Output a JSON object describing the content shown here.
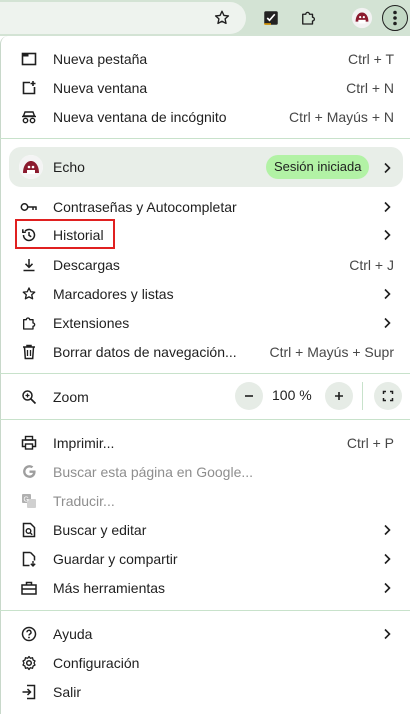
{
  "menu": {
    "new_tab": {
      "label": "Nueva pestaña",
      "shortcut": "Ctrl + T"
    },
    "new_window": {
      "label": "Nueva ventana",
      "shortcut": "Ctrl + N"
    },
    "incognito": {
      "label": "Nueva ventana de incógnito",
      "shortcut": "Ctrl + Mayús + N"
    },
    "profile": {
      "name": "Echo",
      "status": "Sesión iniciada"
    },
    "passwords": {
      "label": "Contraseñas y Autocompletar"
    },
    "history": {
      "label": "Historial"
    },
    "downloads": {
      "label": "Descargas",
      "shortcut": "Ctrl + J"
    },
    "bookmarks": {
      "label": "Marcadores y listas"
    },
    "extensions": {
      "label": "Extensiones"
    },
    "clear_data": {
      "label": "Borrar datos de navegación...",
      "shortcut": "Ctrl + Mayús + Supr"
    },
    "zoom": {
      "label": "Zoom",
      "value": "100 %",
      "minus": "−",
      "plus": "+"
    },
    "print": {
      "label": "Imprimir...",
      "shortcut": "Ctrl + P"
    },
    "search_google": {
      "label": "Buscar esta página en Google..."
    },
    "translate": {
      "label": "Traducir..."
    },
    "find_edit": {
      "label": "Buscar y editar"
    },
    "save_share": {
      "label": "Guardar y compartir"
    },
    "more_tools": {
      "label": "Más herramientas"
    },
    "help": {
      "label": "Ayuda"
    },
    "settings": {
      "label": "Configuración"
    },
    "exit": {
      "label": "Salir"
    }
  },
  "colors": {
    "accent_green": "#b2f2a5",
    "highlight_red": "#e02020",
    "toolbar": "#d3e3d4"
  }
}
